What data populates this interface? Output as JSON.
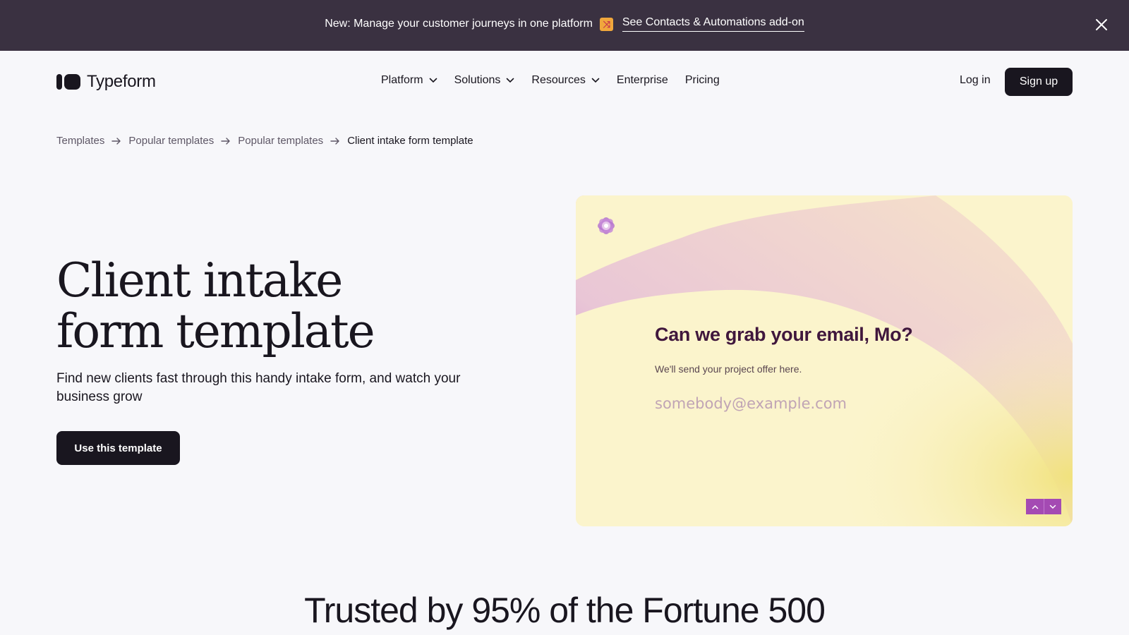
{
  "banner": {
    "text": "New: Manage your customer journeys in one platform",
    "emoji_icon": "shuffle-emoji-icon",
    "link_label": "See Contacts & Automations add-on"
  },
  "nav": {
    "logo_text": "Typeform",
    "menu": [
      {
        "label": "Platform",
        "has_dropdown": true
      },
      {
        "label": "Solutions",
        "has_dropdown": true
      },
      {
        "label": "Resources",
        "has_dropdown": true
      },
      {
        "label": "Enterprise",
        "has_dropdown": false
      },
      {
        "label": "Pricing",
        "has_dropdown": false
      }
    ],
    "login_label": "Log in",
    "signup_label": "Sign up"
  },
  "breadcrumb": [
    "Templates",
    "Popular templates",
    "Popular templates",
    "Client intake form template"
  ],
  "hero": {
    "title_line1": "Client intake",
    "title_line2": "form template",
    "subtitle": "Find new clients fast through this handy intake form, and watch your business grow",
    "cta_label": "Use this template"
  },
  "preview": {
    "question": "Can we grab your email, Mo?",
    "description": "We'll send your project offer here.",
    "input_placeholder": "somebody@example.com",
    "colors": {
      "question": "#40173d",
      "accent": "#a44ab3",
      "background": "#fbf4cc"
    }
  },
  "trusted_heading": "Trusted by 95% of the Fortune 500"
}
